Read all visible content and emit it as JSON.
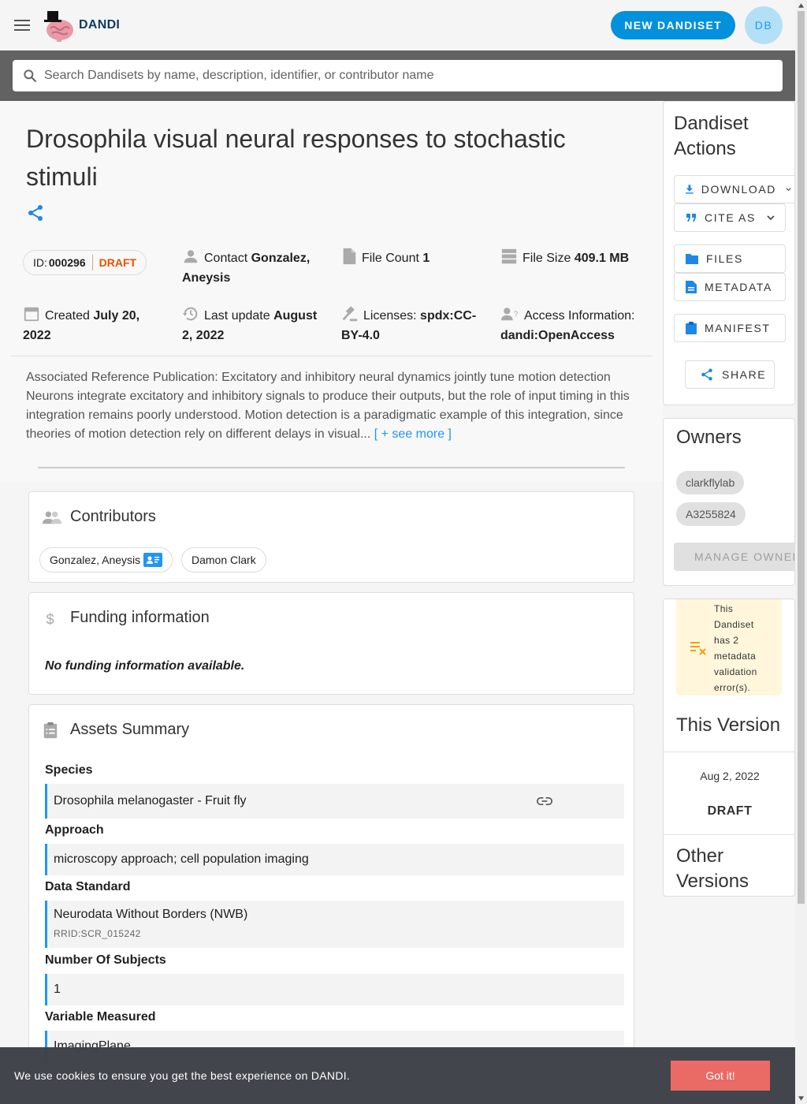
{
  "app": {
    "brand": "DANDI",
    "new_button": "NEW DANDISET",
    "avatar_initials": "DB"
  },
  "search": {
    "placeholder": "Search Dandisets by name, description, identifier, or contributor name"
  },
  "dandiset": {
    "title": "Drosophila visual neural responses to stochastic stimuli",
    "id_label": "ID:",
    "id": "000296",
    "status": "DRAFT",
    "contact_label": "Contact",
    "contact": "Gonzalez, Aneysis",
    "file_count_label": "File Count",
    "file_count": "1",
    "file_size_label": "File Size",
    "file_size": "409.1 MB",
    "created_label": "Created",
    "created": "July 20, 2022",
    "updated_label": "Last update",
    "updated": "August 2, 2022",
    "licenses_label": "Licenses:",
    "license": "spdx:CC-BY-4.0",
    "access_label": "Access Information:",
    "access": "dandi:OpenAccess",
    "description": "Associated Reference Publication: Excitatory and inhibitory neural dynamics jointly tune motion detection Neurons integrate excitatory and inhibitory signals to produce their outputs, but the role of input timing in this integration remains poorly understood. Motion detection is a paradigmatic example of this integration, since theories of motion detection rely on different delays in visual...",
    "see_more": "[ + see more ]"
  },
  "contributors": {
    "title": "Contributors",
    "people": [
      "Gonzalez, Aneysis",
      "Damon Clark"
    ]
  },
  "funding": {
    "title": "Funding information",
    "empty": "No funding information available."
  },
  "assets": {
    "title": "Assets Summary",
    "species_label": "Species",
    "species": "Drosophila melanogaster - Fruit fly",
    "approach_label": "Approach",
    "approach": "microscopy approach; cell population imaging",
    "standard_label": "Data Standard",
    "standard": "Neurodata Without Borders (NWB)",
    "standard_rrid": "RRID:SCR_015242",
    "subjects_label": "Number Of Subjects",
    "subjects": "1",
    "variable_label": "Variable Measured",
    "variable": "ImagingPlane"
  },
  "actions": {
    "title": "Dandiset Actions",
    "download": "DOWNLOAD",
    "cite": "CITE AS",
    "files": "FILES",
    "metadata": "METADATA",
    "manifest": "MANIFEST",
    "share": "SHARE"
  },
  "owners": {
    "title": "Owners",
    "list": [
      "clarkflylab",
      "A3255824"
    ],
    "manage": "MANAGE OWNERS"
  },
  "validation": {
    "message": "This Dandiset has 2 metadata validation error(s)."
  },
  "version": {
    "title": "This Version",
    "date": "Aug 2, 2022",
    "status": "DRAFT",
    "other_title": "Other Versions"
  },
  "cookie": {
    "text": "We use cookies to ensure you get the best experience on DANDI.",
    "button": "Got it!"
  },
  "colors": {
    "accent": "#0390dc",
    "draft": "#e65100",
    "link": "#2196f3",
    "cookie_button": "#ea6a66"
  }
}
